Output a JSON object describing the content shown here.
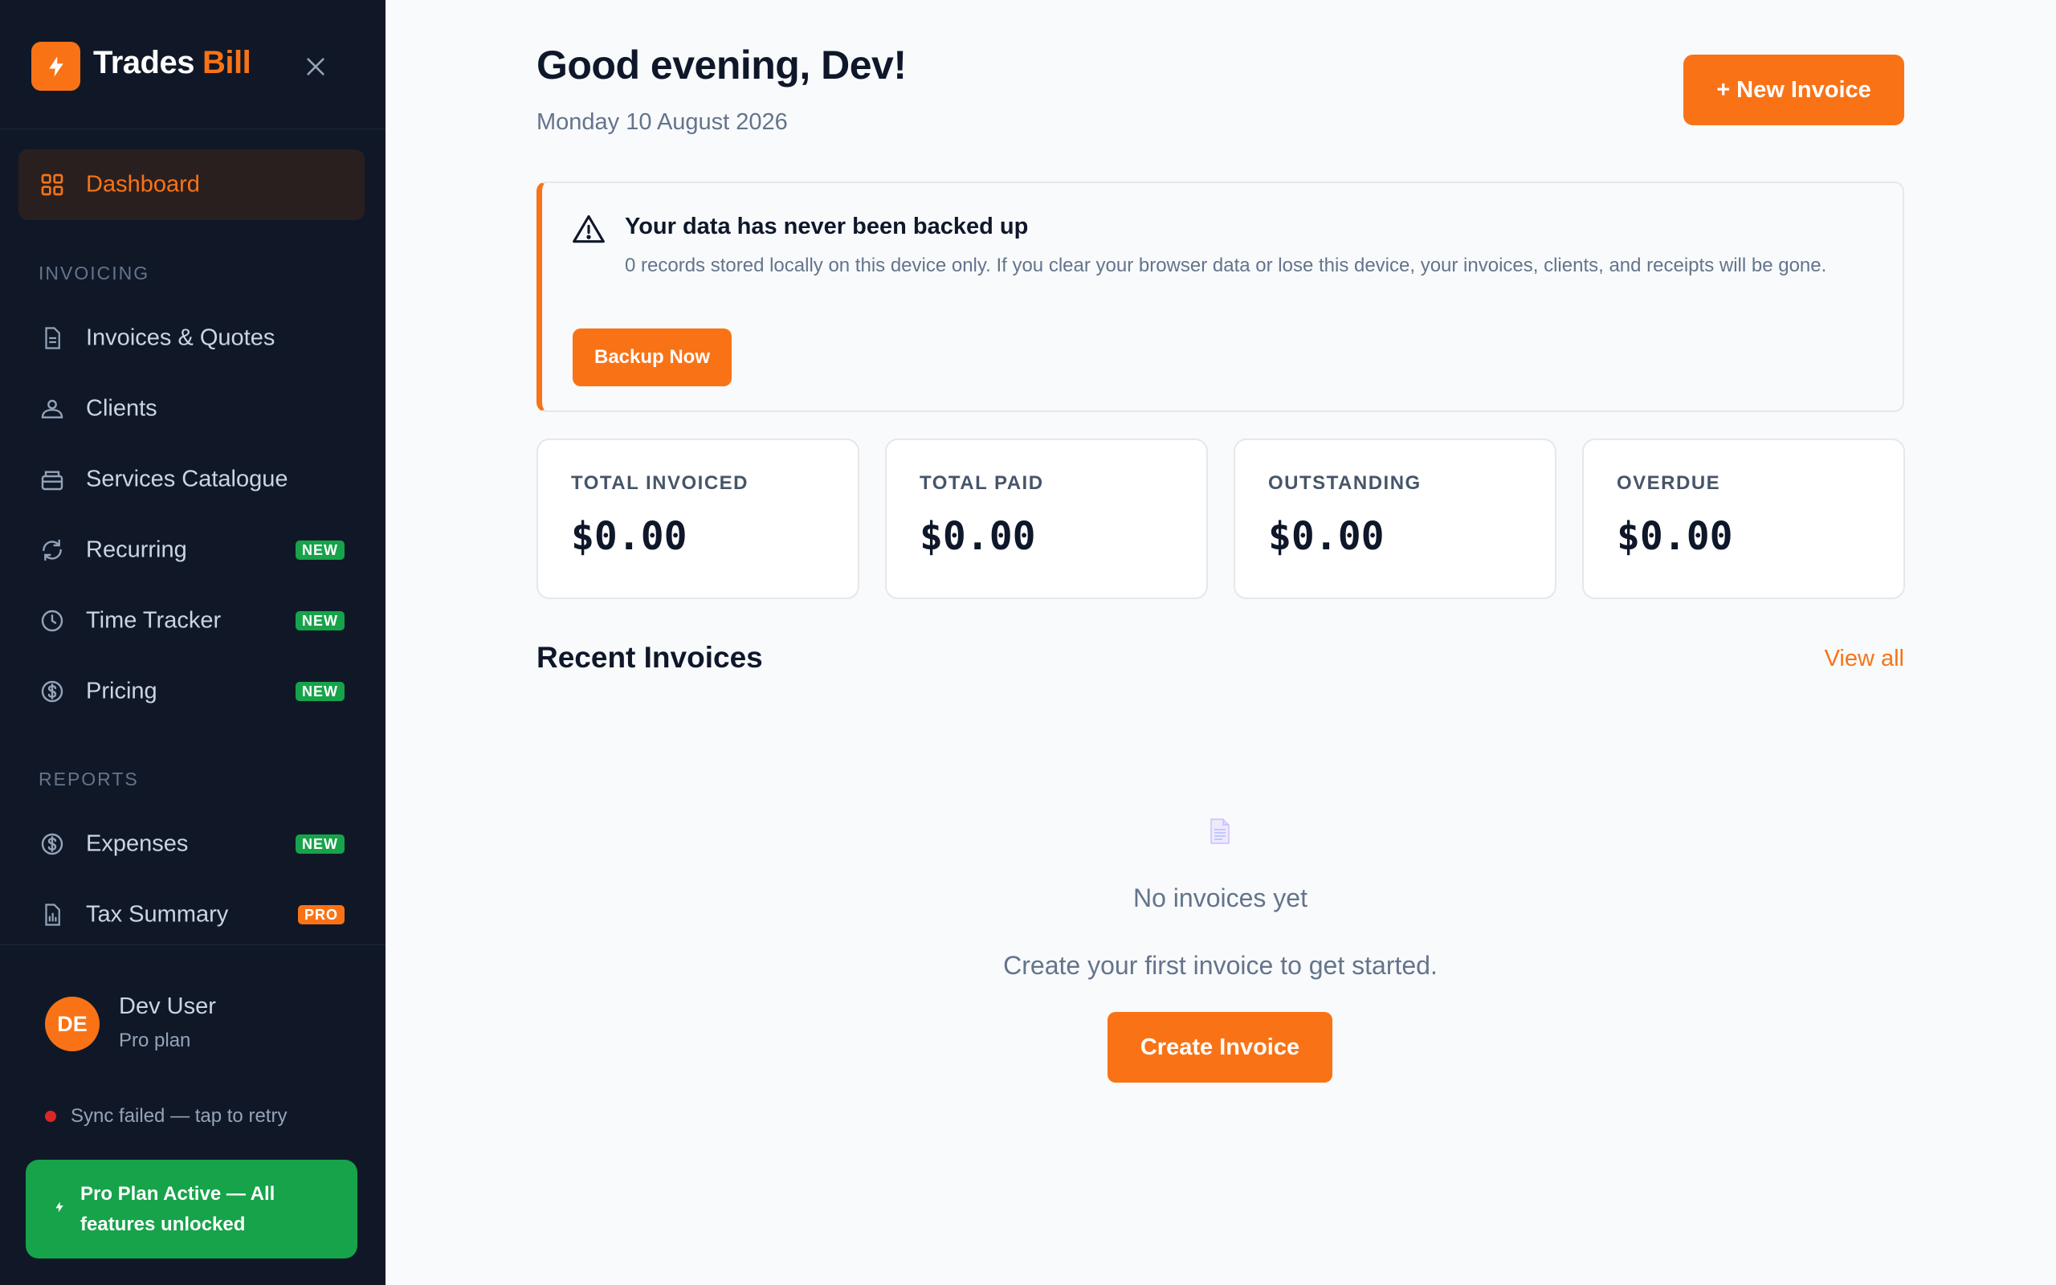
{
  "brand": {
    "name": "Trades",
    "accent": "Bill",
    "logo_icon": "bolt-icon",
    "close_icon": "close-icon"
  },
  "sidebar": {
    "active": {
      "label": "Dashboard",
      "icon": "grid-icon"
    },
    "sections": [
      {
        "label": "INVOICING"
      },
      {
        "label": "REPORTS"
      }
    ],
    "items": [
      {
        "label": "Invoices & Quotes",
        "icon": "document-icon",
        "badge": ""
      },
      {
        "label": "Clients",
        "icon": "users-icon",
        "badge": ""
      },
      {
        "label": "Services Catalogue",
        "icon": "catalogue-icon",
        "badge": ""
      },
      {
        "label": "Recurring",
        "icon": "refresh-icon",
        "badge": "NEW"
      },
      {
        "label": "Time Tracker",
        "icon": "clock-icon",
        "badge": "NEW"
      },
      {
        "label": "Pricing",
        "icon": "dollar-circle-icon",
        "badge": "NEW"
      },
      {
        "label": "Expenses",
        "icon": "dollar-circle-icon",
        "badge": "NEW"
      },
      {
        "label": "Tax Summary",
        "icon": "report-icon",
        "badge": "PRO"
      }
    ],
    "user": {
      "initials": "DE",
      "name": "Dev User",
      "plan": "Pro plan"
    },
    "sync": {
      "text": "Sync failed — tap to retry",
      "status_color": "#dc2626"
    },
    "pro_banner": {
      "text": "Pro Plan Active — All features unlocked",
      "icon": "bolt-icon"
    }
  },
  "header": {
    "greeting": "Good evening, Dev!",
    "date": "Monday 10 August 2026",
    "new_invoice_label": "+ New Invoice"
  },
  "alert": {
    "icon": "warning-icon",
    "title": "Your data has never been backed up",
    "body": "0 records stored locally on this device only. If you clear your browser data or lose this device, your invoices, clients, and receipts will be gone.",
    "button_label": "Backup Now"
  },
  "stats": [
    {
      "label": "TOTAL INVOICED",
      "value": "$0.00"
    },
    {
      "label": "TOTAL PAID",
      "value": "$0.00"
    },
    {
      "label": "OUTSTANDING",
      "value": "$0.00"
    },
    {
      "label": "OVERDUE",
      "value": "$0.00"
    }
  ],
  "recent": {
    "title": "Recent Invoices",
    "view_all_label": "View all",
    "empty_icon": "document-icon",
    "empty_title": "No invoices yet",
    "empty_subtitle": "Create your first invoice to get started.",
    "create_label": "Create Invoice"
  },
  "colors": {
    "accent": "#f97316",
    "sidebar_bg": "#101828",
    "success": "#16a34a",
    "danger": "#dc2626"
  }
}
